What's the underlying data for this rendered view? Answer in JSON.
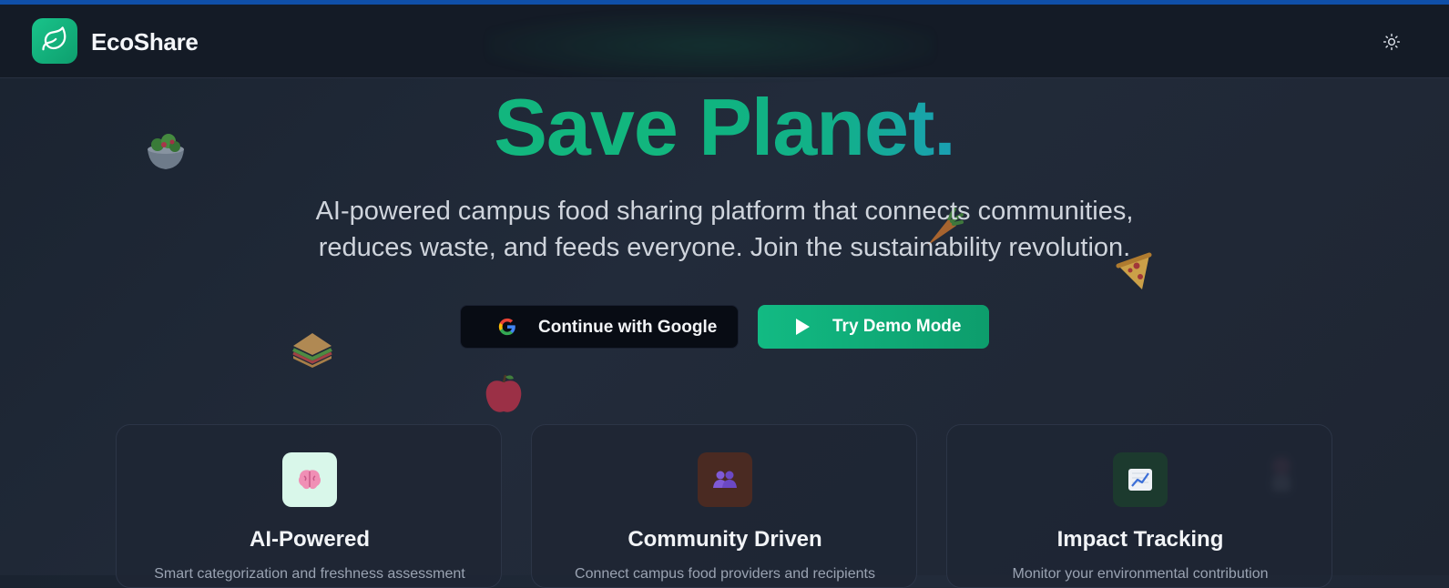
{
  "app": {
    "brand": "EcoShare"
  },
  "hero": {
    "title_word1": "Save",
    "title_word2": "Planet.",
    "subtitle_line1": "AI-powered campus food sharing platform that connects communities,",
    "subtitle_line2": "reduces waste, and feeds everyone. Join the sustainability revolution."
  },
  "actions": {
    "google_label": "Continue with Google",
    "demo_label": "Try Demo Mode"
  },
  "features": [
    {
      "title": "AI-Powered",
      "description": "Smart categorization and freshness assessment",
      "icon": "brain-icon",
      "icon_bg": "#d9f7ea"
    },
    {
      "title": "Community Driven",
      "description": "Connect campus food providers and recipients",
      "icon": "people-icon",
      "icon_bg": "#4a2a22"
    },
    {
      "title": "Impact Tracking",
      "description": "Monitor your environmental contribution",
      "icon": "chart-icon",
      "icon_bg": "#1c3a2e"
    }
  ],
  "decorations": [
    "salad-icon",
    "carrot-icon",
    "pizza-icon",
    "sandwich-icon",
    "apple-icon",
    "blurred-food-icon"
  ],
  "colors": {
    "accent": "#10b47f",
    "accent_teal": "#1a9fb3",
    "top_bar": "#0f4fa8",
    "background": "#1e2532"
  }
}
